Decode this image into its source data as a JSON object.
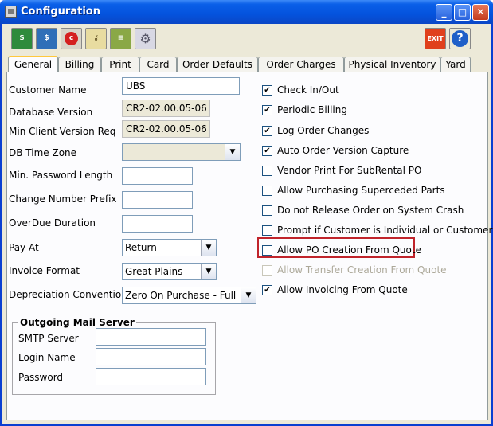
{
  "window": {
    "title": "Configuration"
  },
  "toolbar": {
    "icons": [
      "pay-icon",
      "invoice-icon",
      "cancel-icon",
      "key-user-icon",
      "report-icon",
      "settings-gear-icon"
    ],
    "exit_label": "EXIT",
    "help_label": "?"
  },
  "tabs": [
    "General",
    "Billing",
    "Print",
    "Card",
    "Order Defaults",
    "Order  Charges",
    "Physical Inventory",
    "Yard"
  ],
  "general": {
    "customer_name_label": "Customer Name",
    "customer_name_value": "UBS",
    "db_version_label": "Database Version",
    "db_version_value": "CR2-02.00.05-06",
    "min_client_label": "Min Client Version Req",
    "min_client_value": "CR2-02.00.05-06",
    "db_timezone_label": "DB Time Zone",
    "db_timezone_value": "",
    "min_password_label": "Min. Password Length",
    "change_number_label": "Change Number Prefix",
    "overdue_label": "OverDue Duration",
    "pay_at_label": "Pay At",
    "pay_at_value": "Return",
    "invoice_format_label": "Invoice Format",
    "invoice_format_value": "Great Plains",
    "depreciation_label": "Depreciation Convention",
    "depreciation_value": "Zero On Purchase - Full ..."
  },
  "mail": {
    "title": "Outgoing Mail Server",
    "smtp_label": "SMTP Server",
    "login_label": "Login Name",
    "password_label": "Password"
  },
  "options": [
    {
      "label": "Check In/Out",
      "checked": true,
      "enabled": true
    },
    {
      "label": "Periodic Billing",
      "checked": true,
      "enabled": true
    },
    {
      "label": "Log Order Changes",
      "checked": true,
      "enabled": true
    },
    {
      "label": "Auto Order Version Capture",
      "checked": true,
      "enabled": true
    },
    {
      "label": "Vendor Print For SubRental PO",
      "checked": false,
      "enabled": true
    },
    {
      "label": "Allow Purchasing Superceded Parts",
      "checked": false,
      "enabled": true
    },
    {
      "label": "Do not Release Order on System Crash",
      "checked": false,
      "enabled": true
    },
    {
      "label": "Prompt if Customer is Individual or Customer",
      "checked": false,
      "enabled": true
    },
    {
      "label": "Allow PO Creation From Quote",
      "checked": false,
      "enabled": true
    },
    {
      "label": "Allow Transfer Creation From Quote",
      "checked": false,
      "enabled": false
    },
    {
      "label": "Allow Invoicing From Quote",
      "checked": true,
      "enabled": true
    }
  ],
  "colors": {
    "title_blue": "#0453dd",
    "highlight_red": "#c0242b",
    "tab_accent": "#ffc83c"
  }
}
